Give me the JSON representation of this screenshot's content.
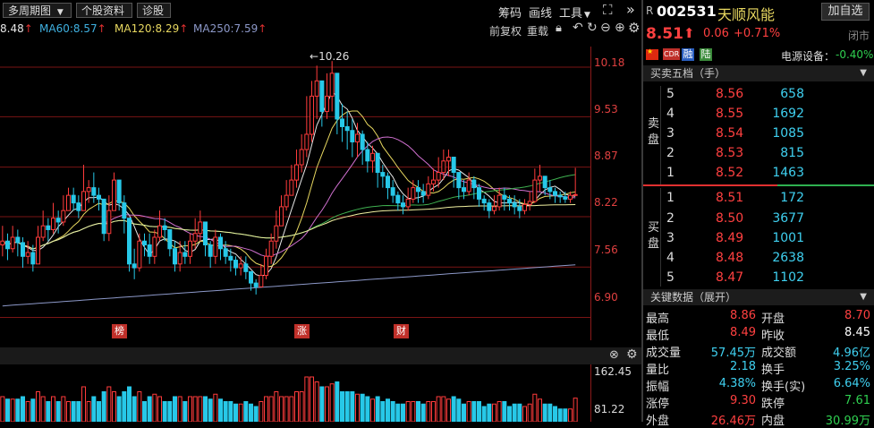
{
  "toolbar": {
    "period": "多周期图",
    "stock_info": "个股资料",
    "diagnose": "诊股",
    "chip": "筹码",
    "draw": "画线",
    "tools": "工具",
    "fq": "前复权",
    "reload": "重载",
    "collapse": "»"
  },
  "ma_legend": [
    {
      "label": "8.48",
      "color": "#e7e7e7"
    },
    {
      "label": "MA60:8.57",
      "color": "#3fb0e0"
    },
    {
      "label": "MA120:8.29",
      "color": "#e8d860"
    },
    {
      "label": "MA250:7.59",
      "color": "#8c98c8"
    }
  ],
  "stock": {
    "prefix": "R",
    "code": "002531",
    "name": "天顺风能",
    "add_watch": "加自选",
    "price": "8.51",
    "change": "0.06",
    "change_pct": "+0.71%",
    "close_status": "闭市",
    "badges": [
      "CDR",
      "融",
      "陆"
    ],
    "sector_name": "电源设备：",
    "sector_change": "-0.40%"
  },
  "orderbook": {
    "title": "买卖五档（手）",
    "sell_label": "卖盘",
    "buy_label": "买盘",
    "sells": [
      {
        "level": "5",
        "price": "8.56",
        "volume": "658"
      },
      {
        "level": "4",
        "price": "8.55",
        "volume": "1692"
      },
      {
        "level": "3",
        "price": "8.54",
        "volume": "1085"
      },
      {
        "level": "2",
        "price": "8.53",
        "volume": "815"
      },
      {
        "level": "1",
        "price": "8.52",
        "volume": "1463"
      }
    ],
    "buys": [
      {
        "level": "1",
        "price": "8.51",
        "volume": "172"
      },
      {
        "level": "2",
        "price": "8.50",
        "volume": "3677"
      },
      {
        "level": "3",
        "price": "8.49",
        "volume": "1001"
      },
      {
        "level": "4",
        "price": "8.48",
        "volume": "2638"
      },
      {
        "level": "5",
        "price": "8.47",
        "volume": "1102"
      }
    ]
  },
  "key_data": {
    "title": "关键数据（展开）",
    "rows": [
      [
        "最高",
        "8.86",
        "开盘",
        "8.70"
      ],
      [
        "最低",
        "8.49",
        "昨收",
        "8.45"
      ],
      [
        "成交量",
        "57.45万",
        "成交额",
        "4.96亿"
      ],
      [
        "量比",
        "2.18",
        "换手",
        "3.25%"
      ],
      [
        "振幅",
        "4.38%",
        "换手(实)",
        "6.64%"
      ],
      [
        "涨停",
        "9.30",
        "跌停",
        "7.61"
      ],
      [
        "外盘",
        "26.46万",
        "内盘",
        "30.99万"
      ]
    ]
  },
  "chart": {
    "yticks": [
      "10.18",
      "9.53",
      "8.87",
      "8.22",
      "7.56",
      "6.90"
    ],
    "max_label": "10.26",
    "events": [
      {
        "label": "榜",
        "xidx": 25
      },
      {
        "label": "涨",
        "xidx": 64
      },
      {
        "label": "财",
        "xidx": 86
      }
    ],
    "vol_ticks": [
      "162.45",
      "81.22"
    ]
  },
  "chart_data": {
    "type": "candlestick",
    "ylim": [
      6.6,
      10.45
    ],
    "close": [
      7.9,
      7.8,
      7.95,
      7.88,
      7.7,
      7.75,
      7.6,
      7.95,
      8.1,
      8.05,
      8.2,
      8.15,
      8.3,
      8.5,
      8.4,
      8.3,
      8.55,
      8.6,
      8.5,
      8.45,
      8.0,
      8.3,
      8.7,
      8.4,
      8.2,
      7.6,
      7.55,
      7.9,
      7.85,
      7.7,
      7.95,
      8.1,
      8.05,
      7.8,
      7.6,
      7.75,
      7.7,
      7.9,
      8.0,
      8.15,
      7.85,
      7.7,
      7.95,
      7.8,
      7.7,
      7.65,
      7.55,
      7.6,
      7.5,
      7.35,
      7.3,
      7.45,
      7.7,
      7.9,
      8.1,
      8.35,
      8.5,
      8.7,
      8.9,
      9.1,
      9.3,
      9.8,
      10.0,
      9.6,
      9.8,
      10.1,
      9.5,
      9.4,
      9.35,
      9.2,
      9.3,
      9.1,
      8.95,
      9.05,
      8.8,
      8.75,
      8.6,
      8.5,
      8.4,
      8.35,
      8.45,
      8.6,
      8.55,
      8.5,
      8.65,
      8.7,
      8.8,
      8.95,
      9.0,
      8.8,
      8.6,
      8.55,
      8.7,
      8.6,
      8.45,
      8.4,
      8.3,
      8.35,
      8.5,
      8.45,
      8.4,
      8.35,
      8.3,
      8.38,
      8.42,
      8.7,
      8.75,
      8.6,
      8.55,
      8.5,
      8.48,
      8.45,
      8.5,
      8.51
    ],
    "high": [
      8.1,
      8.0,
      8.1,
      8.05,
      7.95,
      7.9,
      7.85,
      8.1,
      8.3,
      8.2,
      8.4,
      8.3,
      8.5,
      8.6,
      8.6,
      8.5,
      8.9,
      8.7,
      8.8,
      8.6,
      8.4,
      8.5,
      8.8,
      8.7,
      8.5,
      8.1,
      7.8,
      8.0,
      8.0,
      8.0,
      8.05,
      8.3,
      8.2,
      8.0,
      7.9,
      7.9,
      7.9,
      8.0,
      8.2,
      8.3,
      8.1,
      7.9,
      8.05,
      8.0,
      7.9,
      7.8,
      7.7,
      7.7,
      7.7,
      7.5,
      7.4,
      7.6,
      7.8,
      8.0,
      8.3,
      8.5,
      8.7,
      8.9,
      9.1,
      9.3,
      9.8,
      10.0,
      10.2,
      10.0,
      10.1,
      10.26,
      10.0,
      9.7,
      9.6,
      9.5,
      9.45,
      9.35,
      9.2,
      9.15,
      9.0,
      8.9,
      8.8,
      8.7,
      8.55,
      8.5,
      8.6,
      8.7,
      8.7,
      8.65,
      8.75,
      8.85,
      9.0,
      9.1,
      9.1,
      9.0,
      8.8,
      8.7,
      8.8,
      8.75,
      8.65,
      8.5,
      8.45,
      8.5,
      8.6,
      8.6,
      8.5,
      8.5,
      8.45,
      8.45,
      8.55,
      8.85,
      8.9,
      8.75,
      8.7,
      8.6,
      8.55,
      8.55,
      8.55,
      8.86
    ],
    "low": [
      7.7,
      7.65,
      7.75,
      7.7,
      7.55,
      7.6,
      7.5,
      7.6,
      7.9,
      7.9,
      8.0,
      8.0,
      8.1,
      8.3,
      8.3,
      8.2,
      8.3,
      8.4,
      8.4,
      8.3,
      7.9,
      7.9,
      8.3,
      8.3,
      8.0,
      7.5,
      7.4,
      7.5,
      7.7,
      7.6,
      7.6,
      7.9,
      7.9,
      7.7,
      7.5,
      7.5,
      7.6,
      7.6,
      7.8,
      7.9,
      7.7,
      7.55,
      7.6,
      7.65,
      7.6,
      7.5,
      7.45,
      7.45,
      7.4,
      7.25,
      7.2,
      7.3,
      7.4,
      7.6,
      7.8,
      8.1,
      8.3,
      8.5,
      8.6,
      8.8,
      9.0,
      9.2,
      9.5,
      9.4,
      9.5,
      9.6,
      9.3,
      9.2,
      9.1,
      9.0,
      9.0,
      8.9,
      8.8,
      8.8,
      8.6,
      8.6,
      8.45,
      8.4,
      8.3,
      8.25,
      8.3,
      8.4,
      8.4,
      8.4,
      8.45,
      8.55,
      8.6,
      8.7,
      8.75,
      8.6,
      8.45,
      8.45,
      8.5,
      8.45,
      8.35,
      8.3,
      8.2,
      8.25,
      8.3,
      8.3,
      8.3,
      8.25,
      8.2,
      8.25,
      8.3,
      8.4,
      8.55,
      8.5,
      8.45,
      8.4,
      8.4,
      8.4,
      8.4,
      8.49
    ],
    "ma_lines": [
      "MA5",
      "MA10",
      "MA20",
      "MA60",
      "MA120",
      "MA250"
    ]
  }
}
